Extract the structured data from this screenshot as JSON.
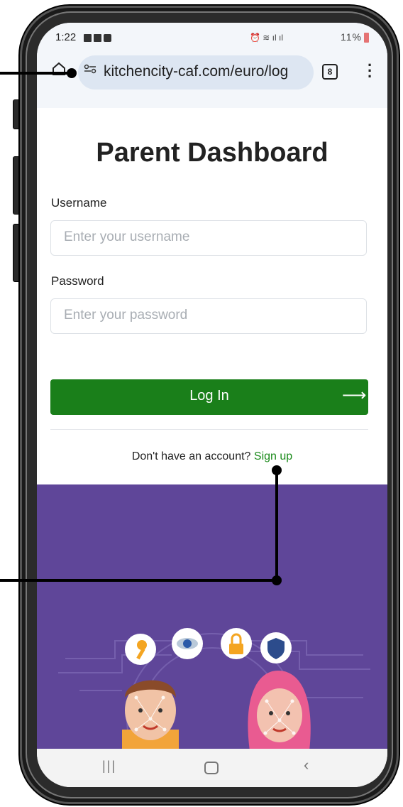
{
  "status_bar": {
    "time": "1:22",
    "battery": "11%"
  },
  "browser": {
    "url": "kitchencity-caf.com/euro/log",
    "tab_count": "8"
  },
  "page": {
    "title": "Parent Dashboard",
    "username_label": "Username",
    "username_placeholder": "Enter your username",
    "password_label": "Password",
    "password_placeholder": "Enter your password",
    "login_label": "Log In",
    "login_arrow": "⟶",
    "signup_prompt": "Don't have an account?",
    "signup_link": "Sign up"
  },
  "colors": {
    "primary_button": "#1a7f1a",
    "link": "#1a8a1a",
    "hero_background": "#5f4699"
  },
  "icons": [
    "home-icon",
    "site-settings-icon",
    "tab-switcher-icon",
    "more-menu-icon",
    "key-icon",
    "eye-icon",
    "padlock-icon",
    "shield-icon",
    "recents-icon",
    "nav-home-icon",
    "back-icon"
  ]
}
